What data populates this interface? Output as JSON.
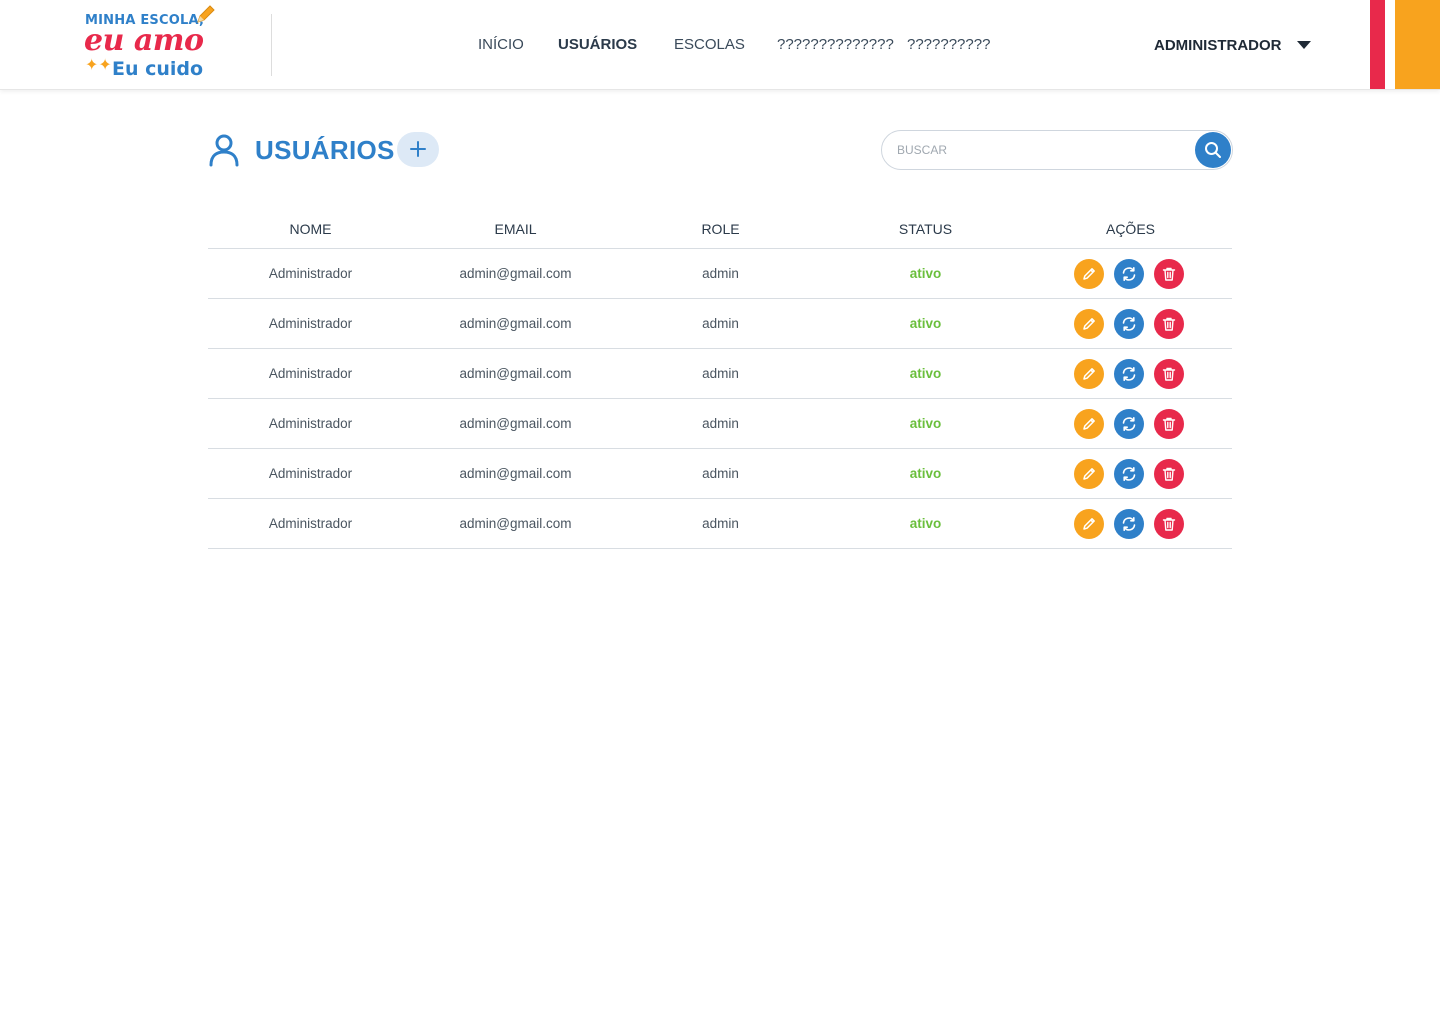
{
  "brand": {
    "line1": "MINHA ESCOLA,",
    "line2": "eu amo",
    "line3": "Eu cuido",
    "colors": {
      "blue": "#2f80c9",
      "red": "#e8294b",
      "orange": "#f8a31e",
      "green": "#6abf3c"
    }
  },
  "nav": {
    "items": [
      {
        "label": "INÍCIO",
        "active": false
      },
      {
        "label": "USUÁRIOS",
        "active": true
      },
      {
        "label": "ESCOLAS",
        "active": false
      },
      {
        "label": "??????????????",
        "active": false
      },
      {
        "label": "??????????",
        "active": false
      }
    ]
  },
  "user_menu": {
    "label": "ADMINISTRADOR",
    "icon": "caret-down-icon"
  },
  "page": {
    "title": "USUÁRIOS",
    "title_icon": "user-icon",
    "add_icon": "plus-icon"
  },
  "search": {
    "placeholder": "BUSCAR",
    "value": "",
    "icon": "search-icon"
  },
  "table": {
    "columns": [
      "NOME",
      "EMAIL",
      "ROLE",
      "STATUS",
      "AÇÕES"
    ],
    "rows": [
      {
        "nome": "Administrador",
        "email": "admin@gmail.com",
        "role": "admin",
        "status": "ativo"
      },
      {
        "nome": "Administrador",
        "email": "admin@gmail.com",
        "role": "admin",
        "status": "ativo"
      },
      {
        "nome": "Administrador",
        "email": "admin@gmail.com",
        "role": "admin",
        "status": "ativo"
      },
      {
        "nome": "Administrador",
        "email": "admin@gmail.com",
        "role": "admin",
        "status": "ativo"
      },
      {
        "nome": "Administrador",
        "email": "admin@gmail.com",
        "role": "admin",
        "status": "ativo"
      },
      {
        "nome": "Administrador",
        "email": "admin@gmail.com",
        "role": "admin",
        "status": "ativo"
      }
    ],
    "action_icons": [
      "pencil-icon",
      "refresh-icon",
      "trash-icon"
    ]
  }
}
